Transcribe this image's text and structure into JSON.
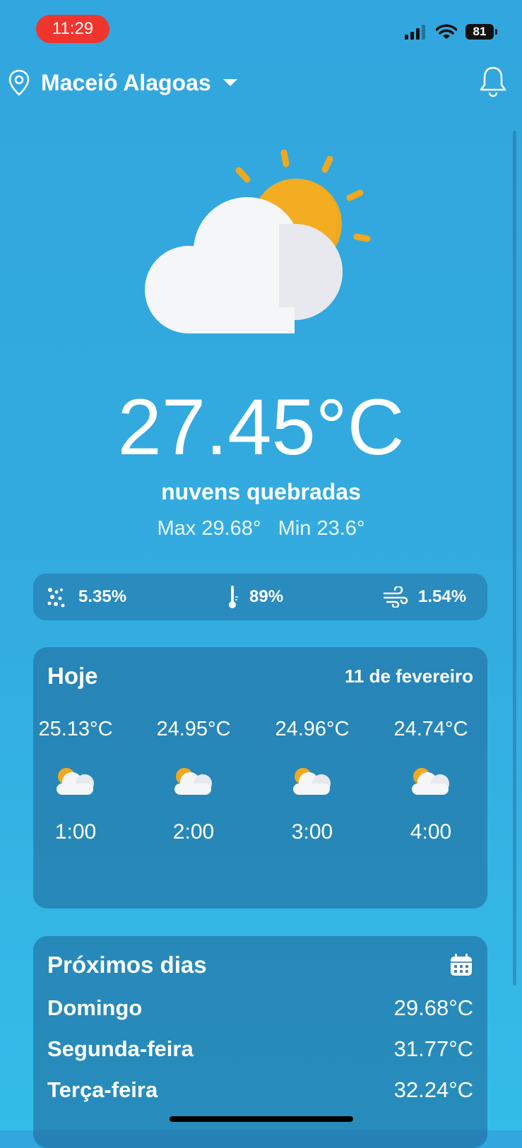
{
  "status_bar": {
    "time": "11:29",
    "battery": "81"
  },
  "header": {
    "location": "Maceió Alagoas"
  },
  "current": {
    "temperature": "27.45°C",
    "condition": "nuvens quebradas",
    "max_min": "Max 29.68°   Min 23.6°"
  },
  "stats": {
    "rain": "5.35%",
    "humidity": "89%",
    "wind": "1.54%"
  },
  "today": {
    "title": "Hoje",
    "date": "11 de fevereiro",
    "hours": [
      {
        "temp": "25.13°C",
        "time": "1:00"
      },
      {
        "temp": "24.95°C",
        "time": "2:00"
      },
      {
        "temp": "24.96°C",
        "time": "3:00"
      },
      {
        "temp": "24.74°C",
        "time": "4:00"
      }
    ]
  },
  "next_days": {
    "title": "Próximos dias",
    "days": [
      {
        "name": "Domingo",
        "temp": "29.68°C"
      },
      {
        "name": "Segunda-feira",
        "temp": "31.77°C"
      },
      {
        "name": "Terça-feira",
        "temp": "32.24°C"
      }
    ]
  },
  "icons": {
    "location": "location-pin-icon",
    "dropdown": "caret-down-icon",
    "bell": "bell-icon",
    "weather": "partly-cloudy-icon",
    "rain": "rain-drops-icon",
    "humidity": "thermometer-icon",
    "wind": "wind-icon",
    "calendar": "calendar-icon"
  },
  "colors": {
    "background": "#32a6de",
    "sun": "#f0a91f",
    "status_pill": "#f0342e"
  }
}
